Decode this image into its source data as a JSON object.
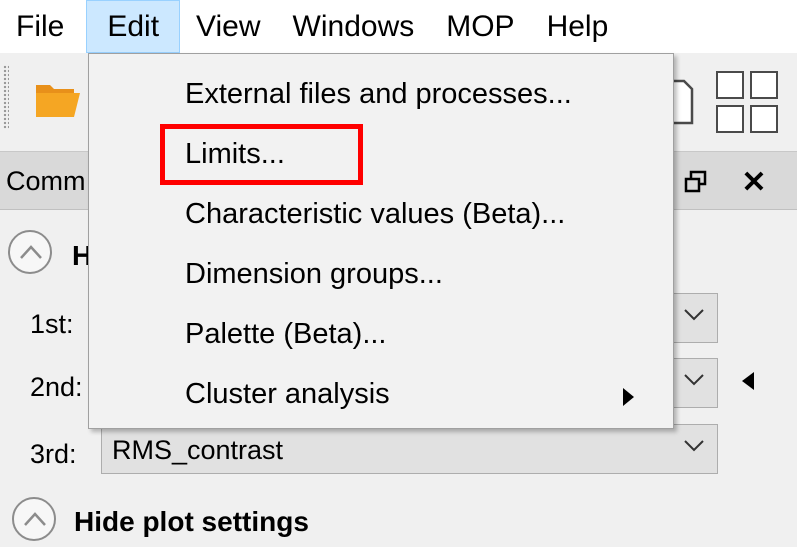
{
  "menubar": {
    "file": "File",
    "edit": "Edit",
    "view": "View",
    "windows": "Windows",
    "mop": "MOP",
    "help": "Help"
  },
  "panel": {
    "title": "Comm",
    "section1_head": "H",
    "rows": [
      {
        "label": "1st:",
        "value": ""
      },
      {
        "label": "2nd:",
        "value": ""
      },
      {
        "label": "3rd:",
        "value": "RMS_contrast"
      }
    ],
    "section2_head": "Hide plot settings"
  },
  "edit_menu": {
    "items": [
      {
        "label": "External files and processes..."
      },
      {
        "label": "Limits...",
        "highlighted": true
      },
      {
        "label": "Characteristic values (Beta)..."
      },
      {
        "label": "Dimension groups..."
      },
      {
        "label": "Palette (Beta)..."
      },
      {
        "label": "Cluster analysis",
        "has_submenu": true
      }
    ]
  },
  "colors": {
    "menu_active_bg": "#cce8ff",
    "highlight_border": "#ff0000",
    "folder_orange": "#f5a623"
  },
  "icons": [
    "folder-open-icon",
    "page-icon",
    "grid-layout-icon",
    "float-window-icon",
    "close-icon",
    "collapse-icon",
    "chevron-down-icon",
    "submenu-arrow-icon"
  ]
}
